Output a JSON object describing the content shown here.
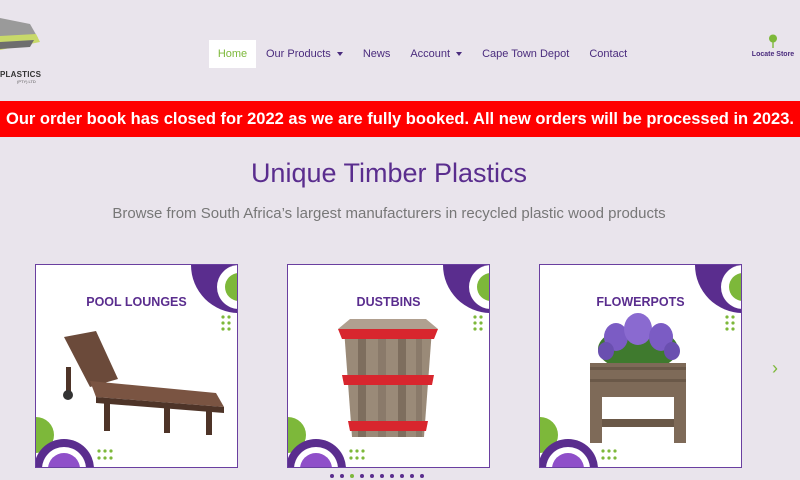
{
  "header": {
    "logo_text": "PLASTICS",
    "logo_sub": "(PTY) LTD",
    "nav": [
      {
        "label": "Home",
        "active": true,
        "dropdown": false
      },
      {
        "label": "Our Products",
        "active": false,
        "dropdown": true
      },
      {
        "label": "News",
        "active": false,
        "dropdown": false
      },
      {
        "label": "Account",
        "active": false,
        "dropdown": true
      },
      {
        "label": "Cape Town Depot",
        "active": false,
        "dropdown": false
      },
      {
        "label": "Contact",
        "active": false,
        "dropdown": false
      }
    ],
    "locate_label": "Locate Store"
  },
  "banner": {
    "text": "Our order book has closed for 2022 as we are fully booked. All new orders will be processed in 2023."
  },
  "main": {
    "title": "Unique Timber Plastics",
    "subtitle": "Browse from South Africa’s largest manufacturers in recycled plastic wood products"
  },
  "carousel": {
    "cards": [
      {
        "title": "POOL LOUNGES",
        "image": "pool-lounge-image"
      },
      {
        "title": "DUSTBINS",
        "image": "dustbin-image"
      },
      {
        "title": "FLOWERPOTS",
        "image": "flowerpot-image"
      }
    ],
    "dot_count": 10,
    "active_dot": 2
  },
  "colors": {
    "brand_purple": "#5a2d8e",
    "accent_green": "#7db83a",
    "banner_red": "#ff0000"
  }
}
